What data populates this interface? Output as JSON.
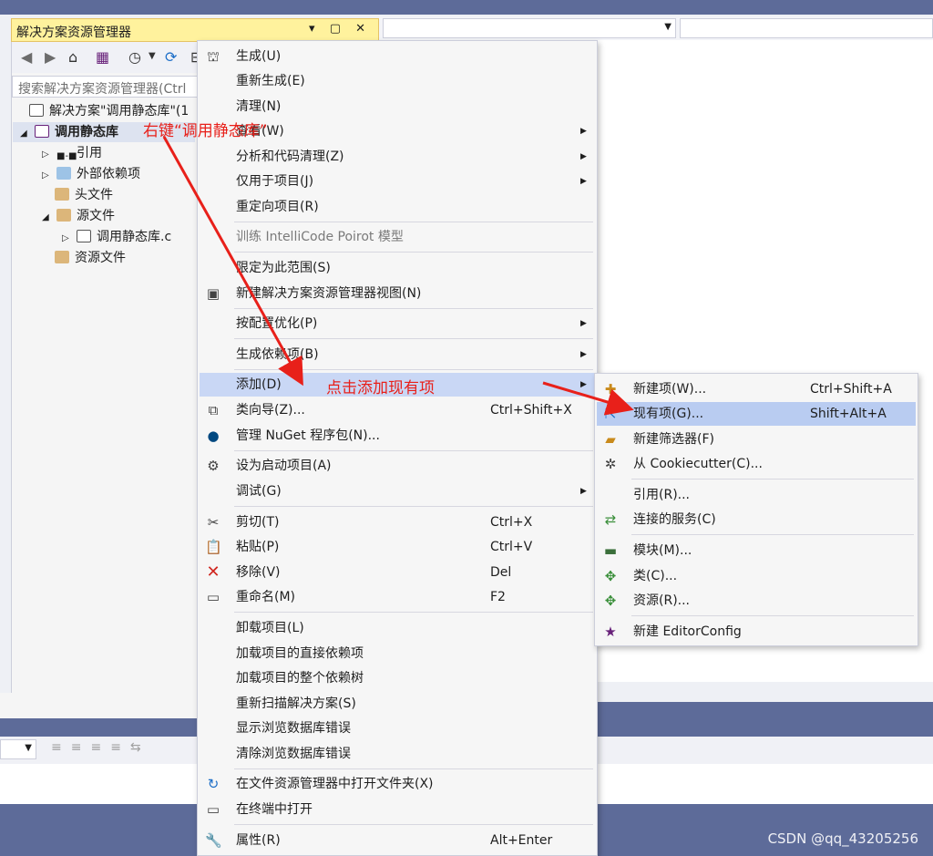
{
  "solution_explorer": {
    "title": "解决方案资源管理器",
    "title_buttons": "▾ ▢ ✕",
    "search_placeholder": "搜索解决方案资源管理器(Ctrl",
    "tree": [
      {
        "label": "解决方案\"调用静态库\"(1",
        "icon": "solution-icon"
      },
      {
        "label": "调用静态库",
        "icon": "project-icon"
      },
      {
        "label": "引用",
        "icon": "references-icon"
      },
      {
        "label": "外部依赖项",
        "icon": "external-deps-icon"
      },
      {
        "label": "头文件",
        "icon": "folder-icon"
      },
      {
        "label": "源文件",
        "icon": "folder-icon"
      },
      {
        "label": "调用静态库.c",
        "icon": "c-file-icon"
      },
      {
        "label": "资源文件",
        "icon": "folder-icon"
      }
    ]
  },
  "context_menu": [
    {
      "label": "生成(U)",
      "icon": "build-icon"
    },
    {
      "label": "重新生成(E)"
    },
    {
      "label": "清理(N)"
    },
    {
      "label": "查看(W)"
    },
    {
      "label": "分析和代码清理(Z)"
    },
    {
      "label": "仅用于项目(J)"
    },
    {
      "label": "重定向项目(R)"
    },
    {
      "label": "训练 IntelliCode Poirot 模型"
    },
    {
      "label": "限定为此范围(S)"
    },
    {
      "label": "新建解决方案资源管理器视图(N)",
      "icon": "new-view-icon"
    },
    {
      "label": "按配置优化(P)"
    },
    {
      "label": "生成依赖项(B)"
    },
    {
      "label": "添加(D)"
    },
    {
      "label": "类向导(Z)...",
      "shortcut": "Ctrl+Shift+X",
      "icon": "class-wizard-icon"
    },
    {
      "label": "管理 NuGet 程序包(N)...",
      "icon": "nuget-icon"
    },
    {
      "label": "设为启动项目(A)",
      "icon": "gear-icon"
    },
    {
      "label": "调试(G)"
    },
    {
      "label": "剪切(T)",
      "shortcut": "Ctrl+X",
      "icon": "scissors-icon"
    },
    {
      "label": "粘贴(P)",
      "shortcut": "Ctrl+V",
      "icon": "paste-icon"
    },
    {
      "label": "移除(V)",
      "shortcut": "Del",
      "icon": "remove-icon"
    },
    {
      "label": "重命名(M)",
      "shortcut": "F2",
      "icon": "rename-icon"
    },
    {
      "label": "卸载项目(L)"
    },
    {
      "label": "加载项目的直接依赖项"
    },
    {
      "label": "加载项目的整个依赖树"
    },
    {
      "label": "重新扫描解决方案(S)"
    },
    {
      "label": "显示浏览数据库错误"
    },
    {
      "label": "清除浏览数据库错误"
    },
    {
      "label": "在文件资源管理器中打开文件夹(X)",
      "icon": "open-folder-icon"
    },
    {
      "label": "在终端中打开",
      "icon": "terminal-icon"
    },
    {
      "label": "属性(R)",
      "shortcut": "Alt+Enter",
      "icon": "wrench-icon"
    }
  ],
  "submenu": [
    {
      "label": "新建项(W)...",
      "shortcut": "Ctrl+Shift+A",
      "icon": "new-item-icon"
    },
    {
      "label": "现有项(G)...",
      "shortcut": "Shift+Alt+A",
      "icon": "existing-item-icon"
    },
    {
      "label": "新建筛选器(F)",
      "icon": "new-filter-icon"
    },
    {
      "label": "从 Cookiecutter(C)...",
      "icon": "cookiecutter-icon"
    },
    {
      "label": "引用(R)..."
    },
    {
      "label": "连接的服务(C)",
      "icon": "connected-service-icon"
    },
    {
      "label": "模块(M)...",
      "icon": "module-icon"
    },
    {
      "label": "类(C)...",
      "icon": "class-icon"
    },
    {
      "label": "资源(R)...",
      "icon": "resource-icon"
    },
    {
      "label": "新建 EditorConfig",
      "icon": "editorconfig-icon"
    }
  ],
  "annotations": {
    "right_click": "右键“调用静态库”",
    "click_add": "点击添加现有项"
  },
  "watermark": "CSDN @qq_43205256",
  "colors": {
    "highlight": "#c9d7f5",
    "annotation": "#e8201a",
    "title_bar": "#fff29d",
    "chrome": "#5d6b99"
  }
}
